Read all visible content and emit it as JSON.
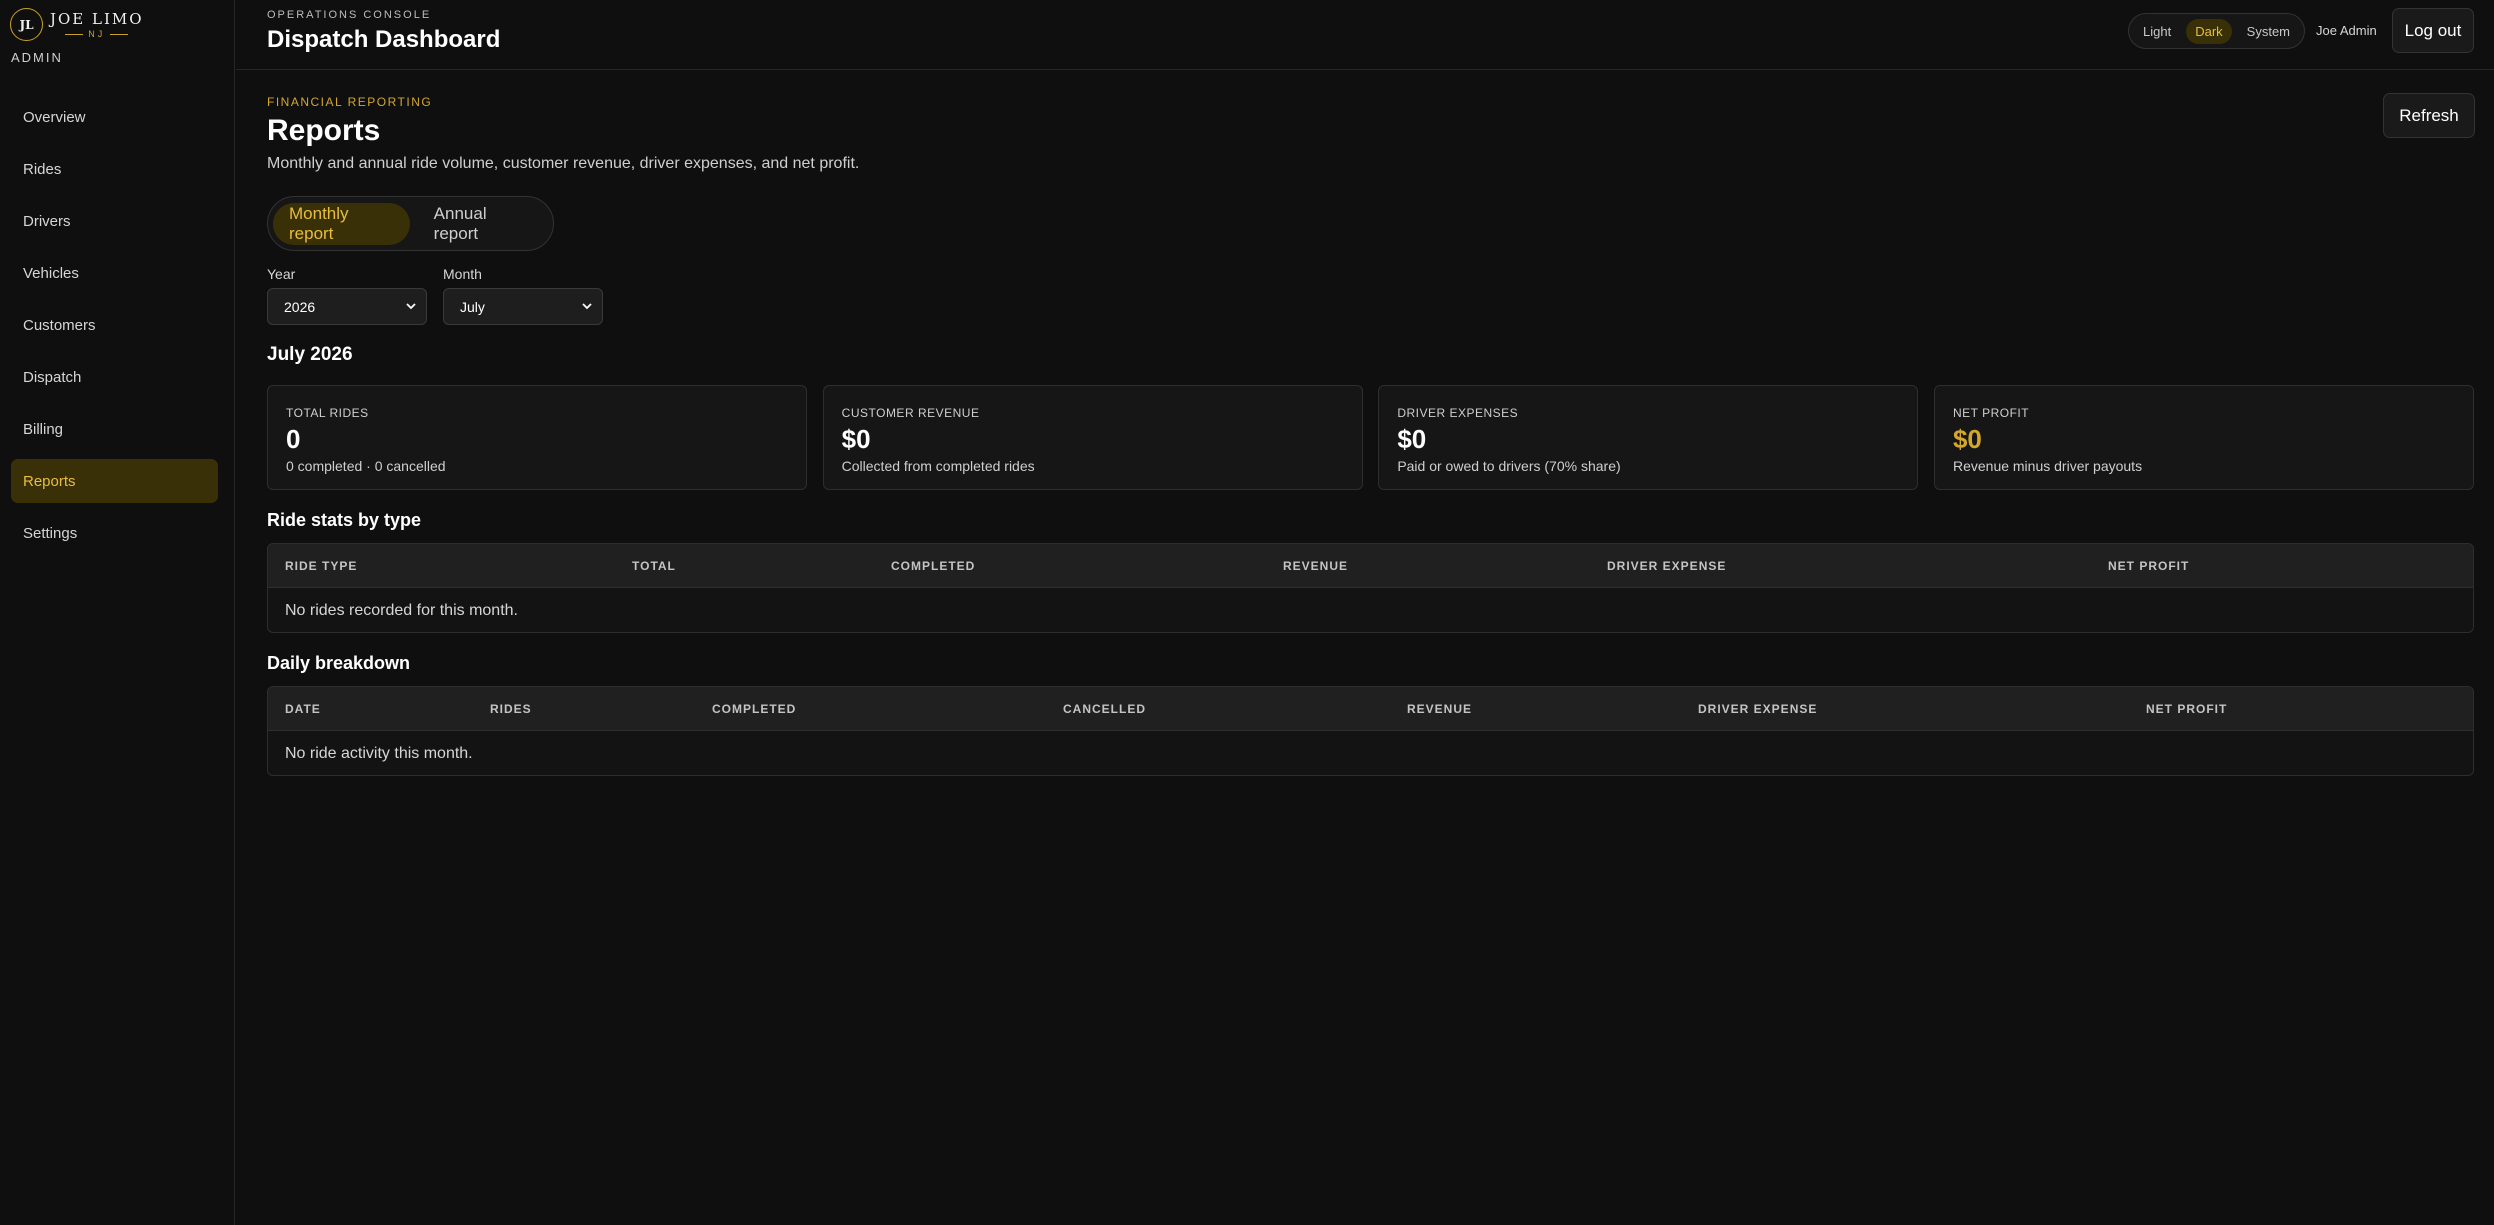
{
  "brand": {
    "mark": "JL",
    "name": "JOE LIMO",
    "sub": "NJ",
    "admin_label": "ADMIN"
  },
  "nav": {
    "items": [
      {
        "label": "Overview"
      },
      {
        "label": "Rides"
      },
      {
        "label": "Drivers"
      },
      {
        "label": "Vehicles"
      },
      {
        "label": "Customers"
      },
      {
        "label": "Dispatch"
      },
      {
        "label": "Billing"
      },
      {
        "label": "Reports",
        "active": true
      },
      {
        "label": "Settings"
      }
    ]
  },
  "header": {
    "eyebrow": "OPERATIONS CONSOLE",
    "title": "Dispatch Dashboard",
    "theme_options": [
      "Light",
      "Dark",
      "System"
    ],
    "theme_selected": "Dark",
    "user_name": "Joe Admin",
    "logout_label": "Log out"
  },
  "page": {
    "eyebrow": "FINANCIAL REPORTING",
    "title": "Reports",
    "description": "Monthly and annual ride volume, customer revenue, driver expenses, and net profit.",
    "refresh_label": "Refresh",
    "report_tabs": [
      "Monthly report",
      "Annual report"
    ],
    "report_selected": "Monthly report",
    "year_label": "Year",
    "year_value": "2026",
    "month_label": "Month",
    "month_value": "July",
    "period_title": "July 2026"
  },
  "cards": [
    {
      "label": "TOTAL RIDES",
      "value": "0",
      "sub": "0 completed · 0 cancelled"
    },
    {
      "label": "CUSTOMER REVENUE",
      "value": "$0",
      "sub": "Collected from completed rides"
    },
    {
      "label": "DRIVER EXPENSES",
      "value": "$0",
      "sub": "Paid or owed to drivers (70% share)"
    },
    {
      "label": "NET PROFIT",
      "value": "$0",
      "sub": "Revenue minus driver payouts"
    }
  ],
  "ride_stats": {
    "title": "Ride stats by type",
    "columns": [
      "RIDE TYPE",
      "TOTAL",
      "COMPLETED",
      "REVENUE",
      "DRIVER EXPENSE",
      "NET PROFIT"
    ],
    "empty": "No rides recorded for this month."
  },
  "daily": {
    "title": "Daily breakdown",
    "columns": [
      "DATE",
      "RIDES",
      "COMPLETED",
      "CANCELLED",
      "REVENUE",
      "DRIVER EXPENSE",
      "NET PROFIT"
    ],
    "empty": "No ride activity this month."
  },
  "colors": {
    "accent": "#d4a72c",
    "active_bg": "#3a3008",
    "background": "#0f0f0f"
  }
}
